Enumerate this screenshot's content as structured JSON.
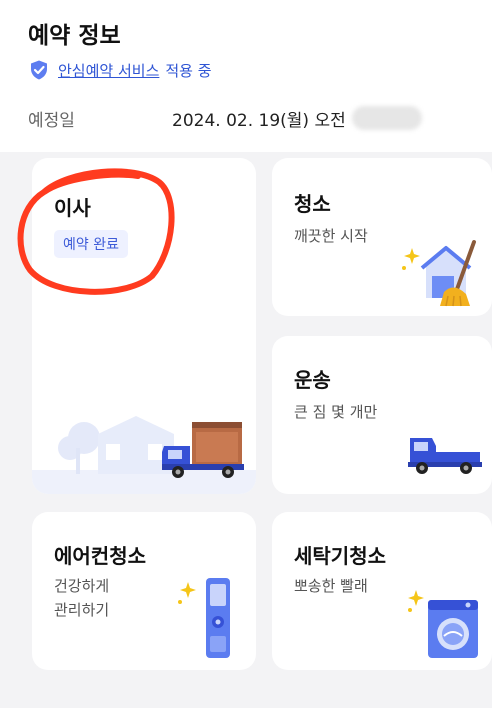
{
  "header": {
    "title": "예약 정보",
    "service_link": "안심예약 서비스",
    "service_suffix": "적용 중",
    "date_label": "예정일",
    "date_value": "2024. 02. 19(월) 오전"
  },
  "cards": {
    "moving": {
      "title": "이사",
      "badge": "예약 완료"
    },
    "cleaning": {
      "title": "청소",
      "subtitle": "깨끗한 시작"
    },
    "delivery": {
      "title": "운송",
      "subtitle": "큰 짐 몇 개만"
    },
    "aircon": {
      "title": "에어컨청소",
      "subtitle_line1": "건강하게",
      "subtitle_line2": "관리하기"
    },
    "washer": {
      "title": "세탁기청소",
      "subtitle": "뽀송한 빨래"
    }
  },
  "colors": {
    "accent": "#2f55d4",
    "badge_bg": "#eef1ff",
    "badge_text": "#3d5bd8",
    "annotation": "#ff3b1f",
    "background": "#f3f3f5"
  }
}
